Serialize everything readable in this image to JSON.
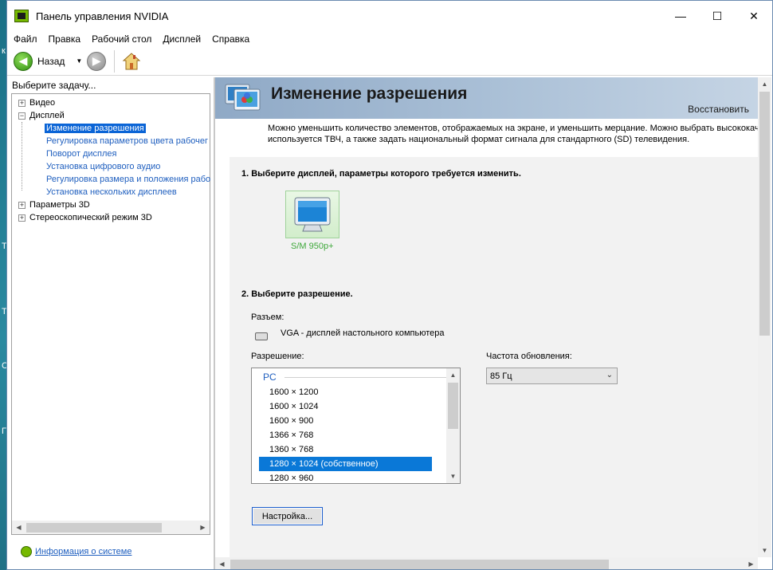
{
  "window": {
    "title": "Панель управления NVIDIA",
    "controls": {
      "minimize": "—",
      "maximize": "☐",
      "close": "✕"
    }
  },
  "menu": [
    "Файл",
    "Правка",
    "Рабочий стол",
    "Дисплей",
    "Справка"
  ],
  "toolbar": {
    "back_label": "Назад"
  },
  "task_label": "Выберите задачу...",
  "tree": {
    "video": "Видео",
    "display": "Дисплей",
    "display_children": [
      "Изменение разрешения",
      "Регулировка параметров цвета рабочег",
      "Поворот дисплея",
      "Установка цифрового аудио",
      "Регулировка размера и положения рабо",
      "Установка нескольких дисплеев"
    ],
    "params3d": "Параметры 3D",
    "stereo": "Стереоскопический режим 3D"
  },
  "system_info": "Информация о системе",
  "header": {
    "title": "Изменение разрешения",
    "restore": "Восстановить"
  },
  "description": {
    "line1": "Можно уменьшить количество элементов, отображаемых на экране, и уменьшить мерцание. Можно выбрать высококач",
    "line2": "используется ТВЧ, а также задать национальный формат сигнала для стандартного (SD) телевидения."
  },
  "step1": "1. Выберите дисплей, параметры которого требуется изменить.",
  "monitor_name": "S/M 950p+",
  "step2": "2. Выберите разрешение.",
  "connector_label": "Разъем:",
  "connector_value": "VGA - дисплей настольного компьютера",
  "resolution_label": "Разрешение:",
  "refresh_label": "Частота обновления:",
  "resolutions": {
    "group": "PC",
    "items": [
      "1600 × 1200",
      "1600 × 1024",
      "1600 × 900",
      "1366 × 768",
      "1360 × 768",
      "1280 × 1024 (собственное)",
      "1280 × 960"
    ]
  },
  "refresh_value": "85 Гц",
  "settings_button": "Настройка...",
  "desktop_chars": [
    "к",
    "Т",
    "Т",
    "Са",
    "Г"
  ],
  "colors": {
    "nvidia_green": "#76b900",
    "selection_blue": "#0a78d7",
    "link_blue": "#1f5fbf"
  }
}
